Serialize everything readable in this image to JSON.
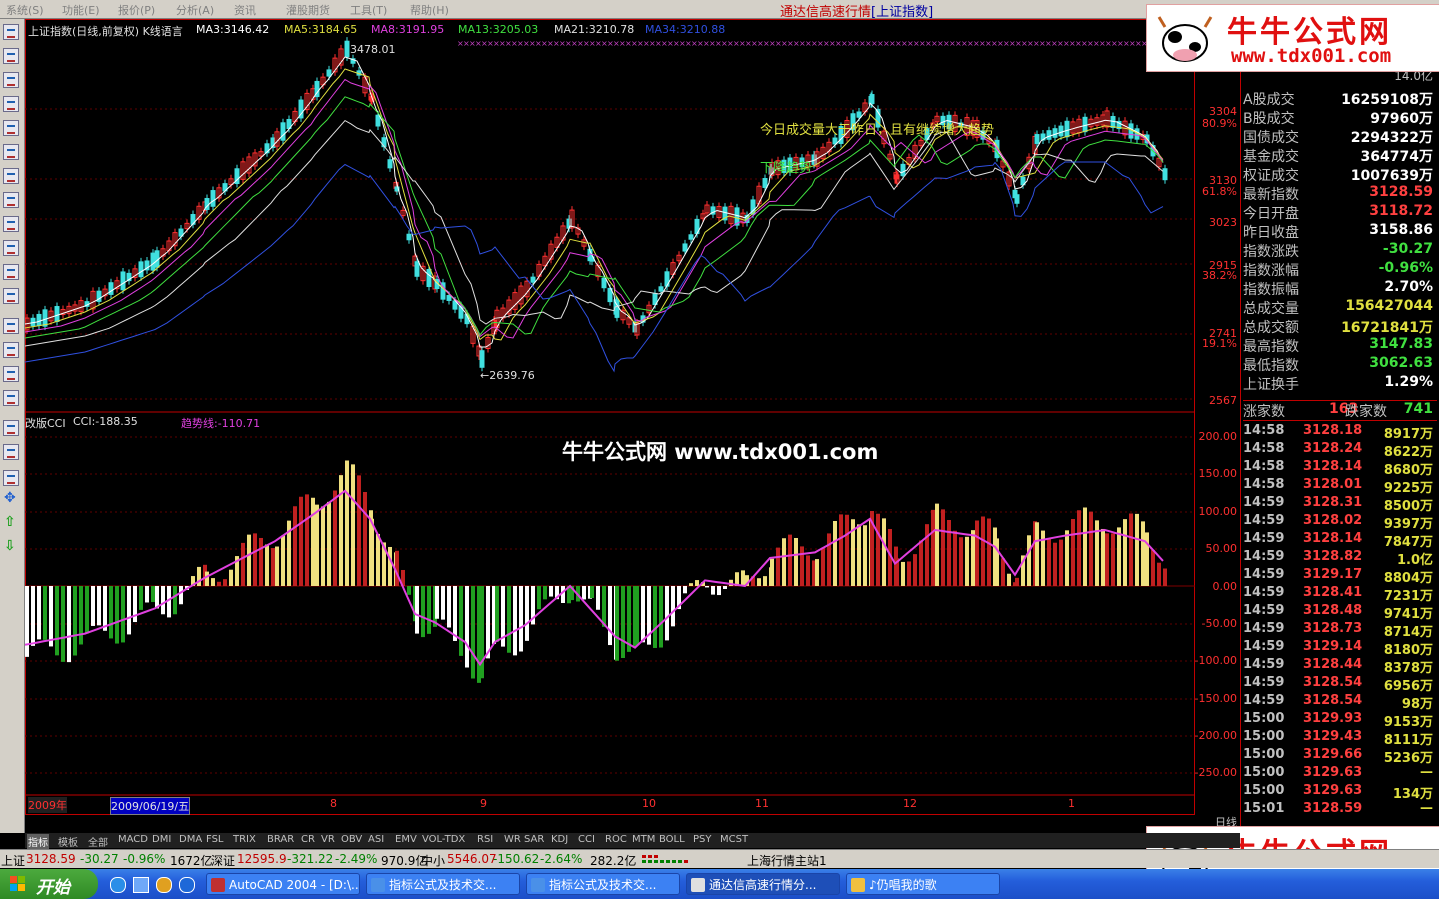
{
  "menu": {
    "items": [
      "系统(S)",
      "功能(E)",
      "报价(P)",
      "分析(A)",
      "资讯",
      "灌股期货",
      "工具(T)",
      "帮助(H)"
    ]
  },
  "app_title": "通达信高速行情",
  "app_subtitle": "[上证指数]",
  "chart_header": {
    "name": "上证指数(日线,前复权) K线语言",
    "ma3": "MA3:3146.42",
    "ma5": "MA5:3184.65",
    "ma8": "MA8:3191.95",
    "ma13": "MA13:3205.03",
    "ma21": "MA21:3210.78",
    "ma34": "MA34:3210.88"
  },
  "annotations": {
    "high": "3478.01",
    "low": "←2639.76",
    "text1": "今日成交量大于昨日，且有继续增大趋势",
    "text2": "下降趋势"
  },
  "price_axis": [
    "3304",
    "80.9%",
    "3130",
    "61.8%",
    "3023",
    "2915",
    "38.2%",
    "2741",
    "19.1%",
    "2567"
  ],
  "cci_header": {
    "name": "改版CCI",
    "cci": "CCI:-188.35",
    "trend": "趋势线:-110.71"
  },
  "cci_axis": [
    "200.00",
    "150.00",
    "100.00",
    "50.00",
    "0.00",
    "-50.00",
    "-100.00",
    "-150.00",
    "-200.00",
    "-250.00"
  ],
  "date_axis": {
    "year": "2009年",
    "cursor_date": "2009/06/19/五",
    "months": [
      "8",
      "9",
      "10",
      "11",
      "12",
      "1"
    ],
    "period": "日线"
  },
  "center_watermark": "牛牛公式网  www.tdx001.com",
  "watermark": {
    "brand": "牛牛公式网",
    "url": "www.tdx001.com"
  },
  "quote_panel": {
    "top_value": "14.0亿",
    "rows": [
      {
        "label": "A股成交",
        "value": "16259108万",
        "color": "#ffffff"
      },
      {
        "label": "B股成交",
        "value": "97960万",
        "color": "#ffffff"
      },
      {
        "label": "国债成交",
        "value": "2294322万",
        "color": "#ffffff"
      },
      {
        "label": "基金成交",
        "value": "364774万",
        "color": "#ffffff"
      },
      {
        "label": "权证成交",
        "value": "1007639万",
        "color": "#ffffff"
      },
      {
        "label": "最新指数",
        "value": "3128.59",
        "color": "#ff4040"
      },
      {
        "label": "今日开盘",
        "value": "3118.72",
        "color": "#ff4040"
      },
      {
        "label": "昨日收盘",
        "value": "3158.86",
        "color": "#ffffff"
      },
      {
        "label": "指数涨跌",
        "value": "-30.27",
        "color": "#40e040"
      },
      {
        "label": "指数涨幅",
        "value": "-0.96%",
        "color": "#40e040"
      },
      {
        "label": "指数振幅",
        "value": "2.70%",
        "color": "#ffffff"
      },
      {
        "label": "总成交量",
        "value": "156427044",
        "color": "#e0e040"
      },
      {
        "label": "总成交额",
        "value": "16721841万",
        "color": "#e0e040"
      },
      {
        "label": "最高指数",
        "value": "3147.83",
        "color": "#40e040"
      },
      {
        "label": "最低指数",
        "value": "3062.63",
        "color": "#40e040"
      },
      {
        "label": "上证换手",
        "value": "1.29%",
        "color": "#ffffff"
      }
    ],
    "up_label": "涨家数",
    "up_value": "163",
    "down_label": "跌家数",
    "down_value": "741"
  },
  "ticks": [
    {
      "time": "14:58",
      "price": "3128.18",
      "vol": "8917万"
    },
    {
      "time": "14:58",
      "price": "3128.24",
      "vol": "8622万"
    },
    {
      "time": "14:58",
      "price": "3128.14",
      "vol": "8680万"
    },
    {
      "time": "14:58",
      "price": "3128.01",
      "vol": "9225万"
    },
    {
      "time": "14:59",
      "price": "3128.31",
      "vol": "8500万"
    },
    {
      "time": "14:59",
      "price": "3128.02",
      "vol": "9397万"
    },
    {
      "time": "14:59",
      "price": "3128.14",
      "vol": "7847万"
    },
    {
      "time": "14:59",
      "price": "3128.82",
      "vol": "1.0亿"
    },
    {
      "time": "14:59",
      "price": "3129.17",
      "vol": "8804万"
    },
    {
      "time": "14:59",
      "price": "3128.41",
      "vol": "7231万"
    },
    {
      "time": "14:59",
      "price": "3128.48",
      "vol": "9741万"
    },
    {
      "time": "14:59",
      "price": "3128.73",
      "vol": "8714万"
    },
    {
      "time": "14:59",
      "price": "3129.14",
      "vol": "8180万"
    },
    {
      "time": "14:59",
      "price": "3128.44",
      "vol": "8378万"
    },
    {
      "time": "14:59",
      "price": "3128.54",
      "vol": "6956万"
    },
    {
      "time": "14:59",
      "price": "3128.54",
      "vol": "98万"
    },
    {
      "time": "15:00",
      "price": "3129.93",
      "vol": "9153万"
    },
    {
      "time": "15:00",
      "price": "3129.43",
      "vol": "8111万"
    },
    {
      "time": "15:00",
      "price": "3129.66",
      "vol": "5236万"
    },
    {
      "time": "15:00",
      "price": "3129.63",
      "vol": "—"
    },
    {
      "time": "15:00",
      "price": "3129.63",
      "vol": "134万"
    },
    {
      "time": "15:01",
      "price": "3128.59",
      "vol": "—"
    }
  ],
  "indicator_tabs": [
    "指标",
    "模板",
    "全部",
    "MACD",
    "DMI",
    "DMA",
    "FSL",
    "TRIX",
    "BRAR",
    "CR",
    "VR",
    "OBV",
    "ASI",
    "EMV",
    "VOL-TDX",
    "RSI",
    "WR",
    "SAR",
    "KDJ",
    "CCI",
    "ROC",
    "MTM",
    "BOLL",
    "PSY",
    "MCST"
  ],
  "status_bar": {
    "sh_label": "上证",
    "sh_price": "3128.59",
    "sh_change": "-30.27",
    "sh_pct": "-0.96%",
    "sh_amount": "1672亿",
    "sz_label": "深证",
    "sz_price": "12595.9",
    "sz_change": "-321.22",
    "sz_pct": "-2.49%",
    "sz_amount": "970.9亿",
    "zx_label": "中小",
    "zx_price": "5546.07",
    "zx_change": "-150.62",
    "zx_pct": "-2.64%",
    "zx_amount": "282.2亿",
    "server": "上海行情主站1"
  },
  "taskbar": {
    "start": "开始",
    "tasks": [
      "AutoCAD 2004 - [D:\\...",
      "指标公式及技术交...",
      "指标公式及技术交...",
      "通达信高速行情分...",
      "♪仍唱我的歌"
    ]
  }
}
